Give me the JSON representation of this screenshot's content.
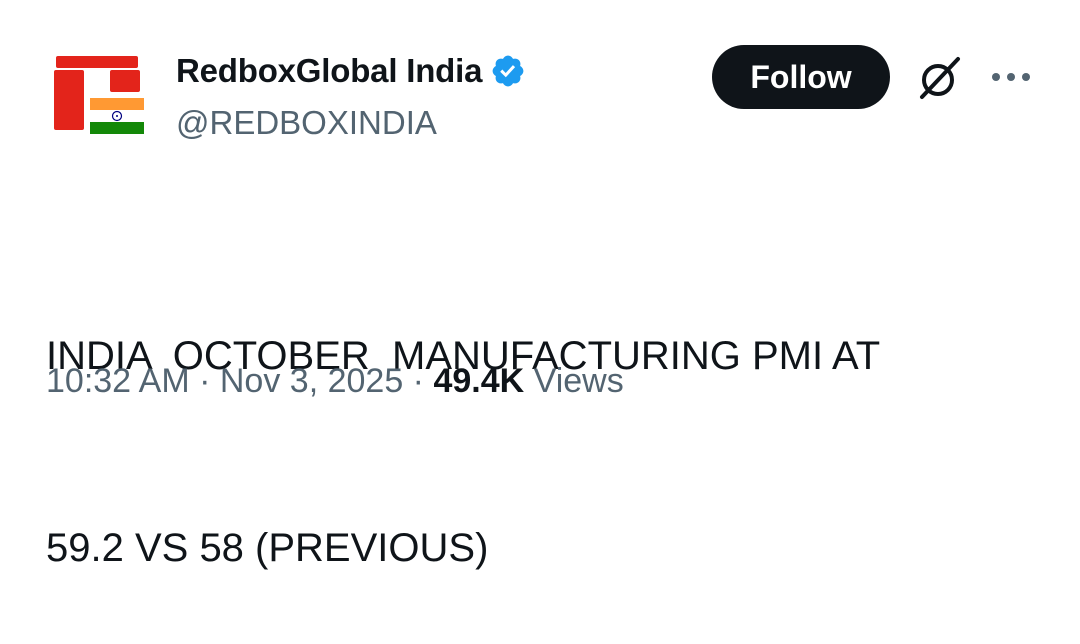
{
  "author": {
    "display_name": "RedboxGlobal India",
    "handle": "@REDBOXINDIA",
    "verified_icon": "verified-badge-icon",
    "verified_color": "#1d9bf0"
  },
  "actions": {
    "follow_label": "Follow",
    "grok_icon": "grok-icon",
    "more_icon": "more-options-icon"
  },
  "tweet": {
    "line1": "INDIA  OCTOBER  MANUFACTURING PMI AT",
    "line2": "59.2 VS 58 (PREVIOUS)"
  },
  "meta": {
    "time": "10:32 AM",
    "sep1": " · ",
    "date": "Nov 3, 2025",
    "sep2": " · ",
    "views_count": "49.4K",
    "views_label": " Views"
  },
  "colors": {
    "text": "#0f1419",
    "secondary": "#536471",
    "brand_red": "#e3241b",
    "saffron": "#ff9933",
    "india_green": "#138808"
  }
}
